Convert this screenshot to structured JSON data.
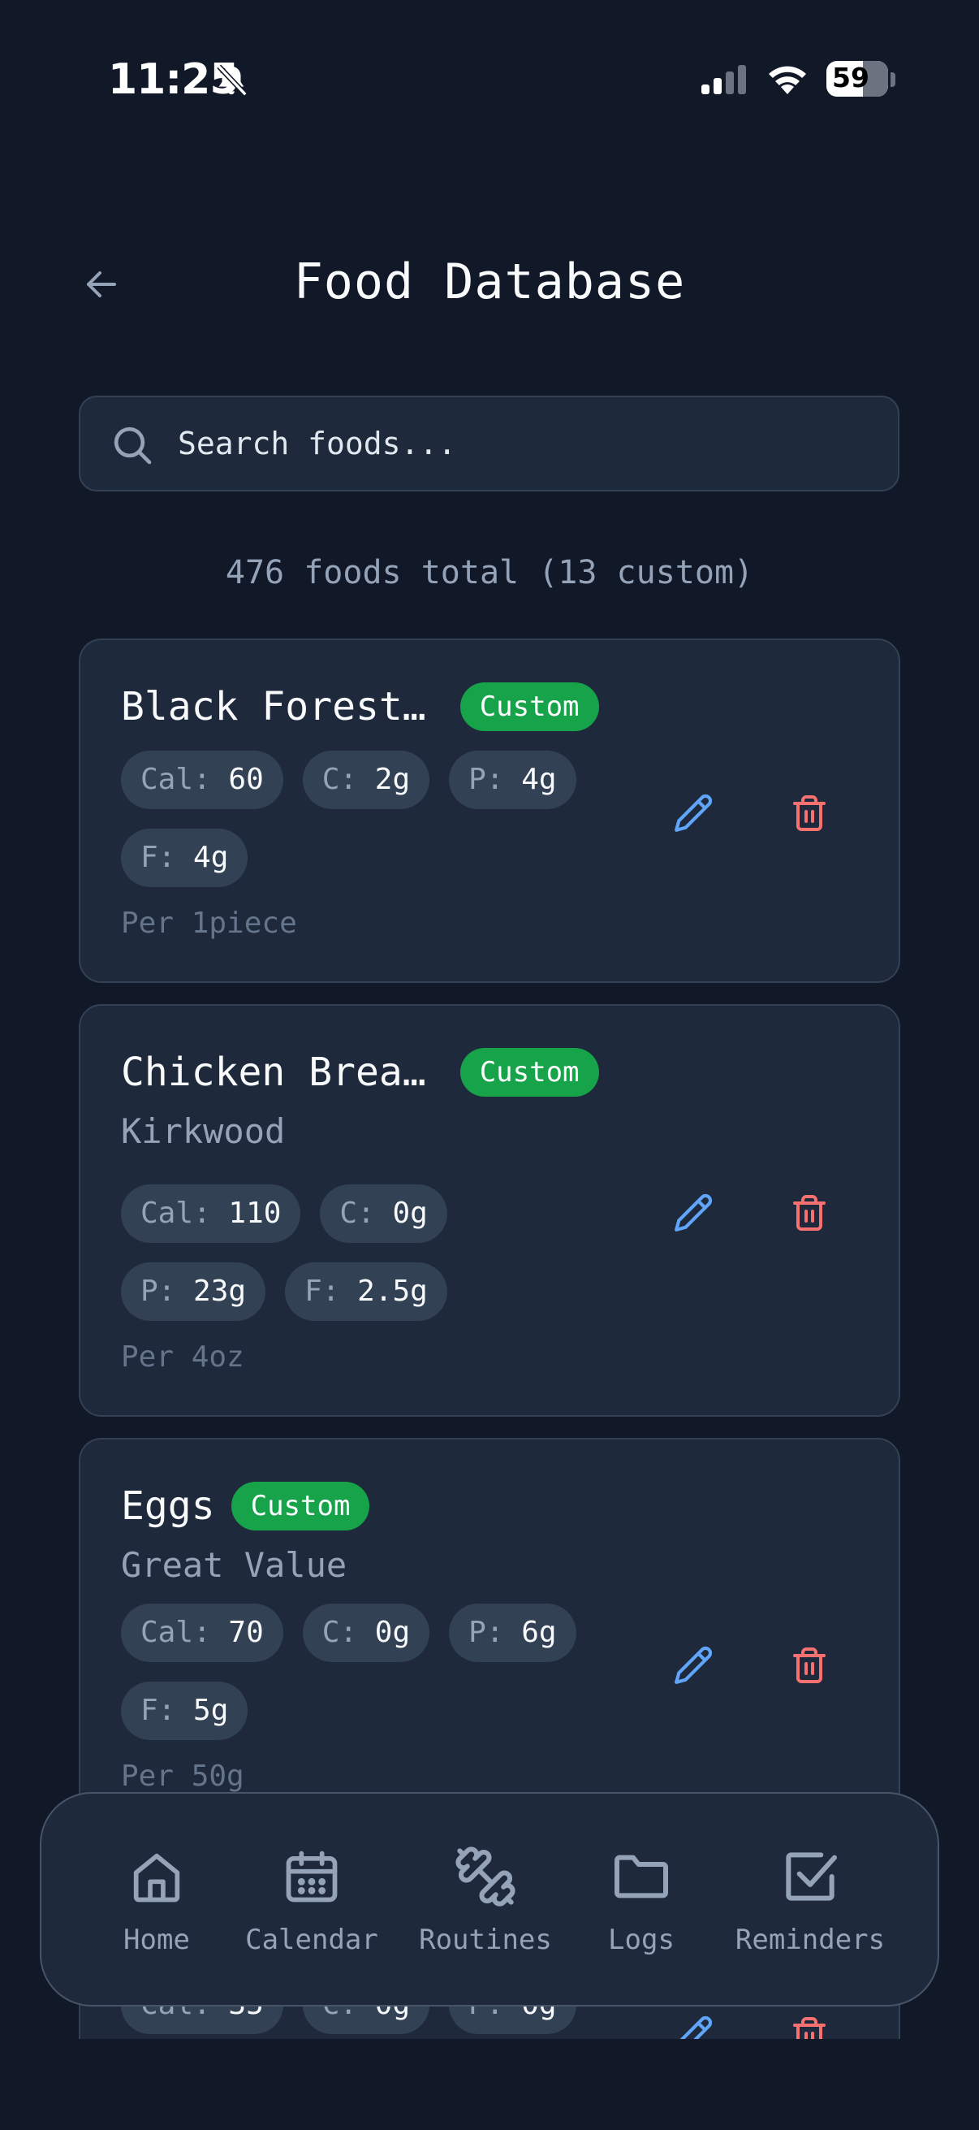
{
  "status_bar": {
    "time": "11:25",
    "battery": "59",
    "battery_level": 0.59
  },
  "header": {
    "title": "Food Database"
  },
  "search": {
    "placeholder": "Search foods..."
  },
  "summary": "476 foods total (13 custom)",
  "foods": [
    {
      "name": "Black Forest…",
      "badge": "Custom",
      "brand": "",
      "macros": [
        {
          "key": "Cal:",
          "value": "60"
        },
        {
          "key": "C:",
          "value": "2g"
        },
        {
          "key": "P:",
          "value": "4g"
        },
        {
          "key": "F:",
          "value": "4g"
        }
      ],
      "serving": "Per 1piece"
    },
    {
      "name": "Chicken Brea…",
      "badge": "Custom",
      "brand": "Kirkwood",
      "macros": [
        {
          "key": "Cal:",
          "value": "110"
        },
        {
          "key": "C:",
          "value": "0g"
        },
        {
          "key": "P:",
          "value": "23g"
        },
        {
          "key": "F:",
          "value": "2.5g"
        }
      ],
      "serving": "Per 4oz"
    },
    {
      "name": "Eggs",
      "badge": "Custom",
      "brand": "Great Value",
      "macros": [
        {
          "key": "Cal:",
          "value": "70"
        },
        {
          "key": "C:",
          "value": "0g"
        },
        {
          "key": "P:",
          "value": "6g"
        },
        {
          "key": "F:",
          "value": "5g"
        }
      ],
      "serving": "Per 50g"
    },
    {
      "name": "",
      "badge": "",
      "brand": "",
      "macros": [
        {
          "key": "Cal:",
          "value": "35"
        },
        {
          "key": "C:",
          "value": "0g"
        },
        {
          "key": "P:",
          "value": "0g"
        }
      ],
      "serving": ""
    }
  ],
  "nav": [
    {
      "label": "Home",
      "icon": "home-icon"
    },
    {
      "label": "Calendar",
      "icon": "calendar-icon"
    },
    {
      "label": "Routines",
      "icon": "dumbbell-icon"
    },
    {
      "label": "Logs",
      "icon": "folder-icon"
    },
    {
      "label": "Reminders",
      "icon": "checkbox-icon"
    }
  ],
  "colors": {
    "background": "#111827",
    "card": "#1e293b",
    "border": "#334155",
    "custom_badge": "#16a34a",
    "edit": "#60a5fa",
    "delete": "#f87171",
    "muted_text": "#94a3b8"
  }
}
